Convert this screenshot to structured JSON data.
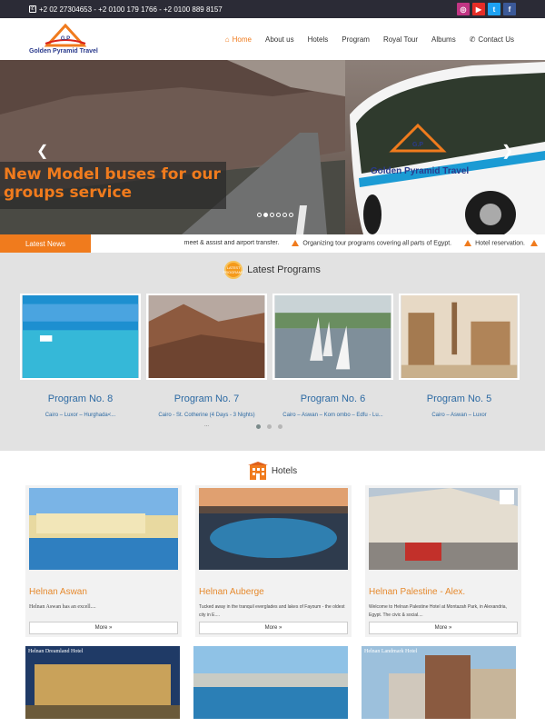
{
  "topbar": {
    "phones": "+2 02 27304653 - +2 0100 179 1766 - +2 0100 889 8157",
    "social": [
      {
        "icon": "instagram-icon",
        "glyph": "◎",
        "color": "#c13584"
      },
      {
        "icon": "youtube-icon",
        "glyph": "▶",
        "color": "#e52d27"
      },
      {
        "icon": "twitter-icon",
        "glyph": "t",
        "color": "#1da1f2"
      },
      {
        "icon": "facebook-icon",
        "glyph": "f",
        "color": "#3b5998"
      }
    ]
  },
  "header": {
    "logo_text": "Golden Pyramid Travel",
    "logo_mark": "G.P",
    "nav": [
      "Home",
      "About us",
      "Hotels",
      "Program",
      "Royal Tour",
      "Albums",
      "Contact Us"
    ]
  },
  "slider": {
    "caption_line1": "New Model buses for our",
    "caption_line2": "groups service",
    "bus_text": "Golden Pyramid Travel",
    "bus_mark": "G.P"
  },
  "news": {
    "label": "Latest News",
    "items": [
      "meet & assist and airport transfer.",
      "Organizing tour programs covering all parts of Egypt.",
      "Hotel reservation."
    ]
  },
  "programs": {
    "title": "Latest Programs",
    "badge": "LATEST PROGRAMS",
    "items": [
      {
        "title": "Program No. 8",
        "desc": "Cairo – Luxor – Hurghada<...",
        "more": ""
      },
      {
        "title": "Program No. 7",
        "desc": "Cairo - St. Cotherine (4 Days - 3 Nights)",
        "more": "..."
      },
      {
        "title": "Program No. 6",
        "desc": "Cairo – Aswan – Kom ombo – Edfu - Lu...",
        "more": ""
      },
      {
        "title": "Program No. 5",
        "desc": "Cairo – Aswan – Luxor",
        "more": ""
      }
    ]
  },
  "hotels": {
    "title": "Hotels",
    "items": [
      {
        "name": "Helnan Aswan",
        "text": "Helnan Aswan has an excell....",
        "more": "More »"
      },
      {
        "name": "Helnan Auberge",
        "text": "Tucked away in the tranquil everglades and lakes of Fayoum - the oldest city in E....",
        "more": "More »"
      },
      {
        "name": "Helnan Palestine - Alex.",
        "text": "Welcome to Helnan Palestine Hotel at Montazah Park, in Alexandria, Egypt. The civic & social....",
        "more": "More »"
      }
    ],
    "row2_labels": [
      "Helnan Dreamland Hotel",
      "",
      "Helnan Landmark Hotel"
    ]
  }
}
